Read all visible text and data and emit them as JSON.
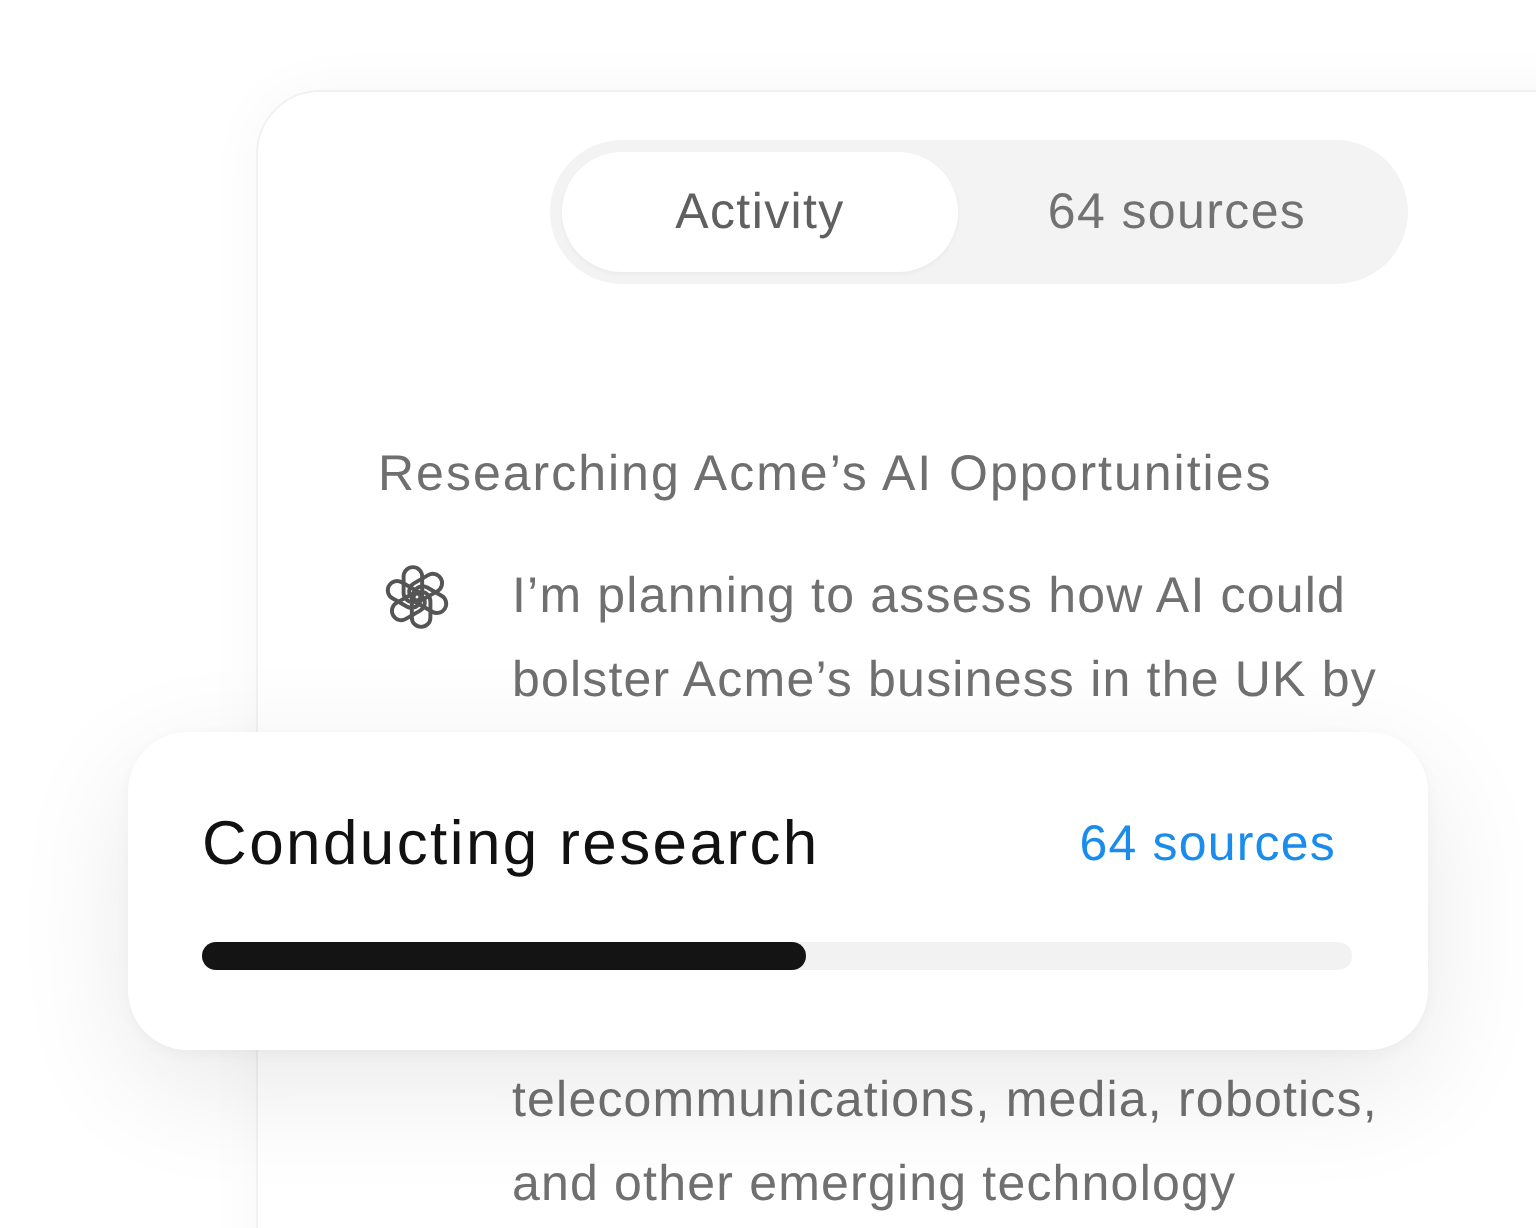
{
  "tabs": [
    {
      "label": "Activity",
      "selected": true
    },
    {
      "label": "64 sources",
      "selected": false
    }
  ],
  "activity": {
    "heading": "Researching Acme’s AI Opportunities",
    "message_parts": [
      [
        "I’m planning to assess how AI could",
        "bolster Acme’s business in the UK by"
      ],
      [
        "telecommunications, media, robotics,",
        "and other emerging technology"
      ]
    ]
  },
  "progress_card": {
    "title": "Conducting research",
    "sources": "64 sources",
    "level": 0.525
  }
}
